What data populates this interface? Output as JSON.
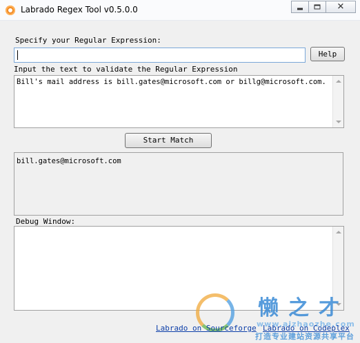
{
  "window": {
    "title": "Labrado Regex Tool v0.5.0.0",
    "controls": {
      "minimize": "",
      "maximize": "",
      "close": "✕"
    }
  },
  "regex": {
    "label": "Specify your Regular Expression:",
    "value": "",
    "help_label": "Help"
  },
  "input": {
    "label": "Input the text to validate the Regular Expression",
    "text": "Bill's mail address is bill.gates@microsoft.com or billg@microsoft.com."
  },
  "actions": {
    "start_match_label": "Start Match"
  },
  "result": {
    "text": "bill.gates@microsoft.com"
  },
  "debug": {
    "label": "Debug Window:",
    "text": ""
  },
  "links": {
    "sourceforge": "Labrado on Sourceforge",
    "codeplex": "Labrado on Codeplex"
  },
  "watermark": {
    "title": "懒之才",
    "url": "www.aizhaozhe.com",
    "tagline": "打造专业建站资源共享平台"
  },
  "colors": {
    "accent": "#f08a24",
    "link": "#0b3da8",
    "watermark": "#3a8bd6"
  }
}
